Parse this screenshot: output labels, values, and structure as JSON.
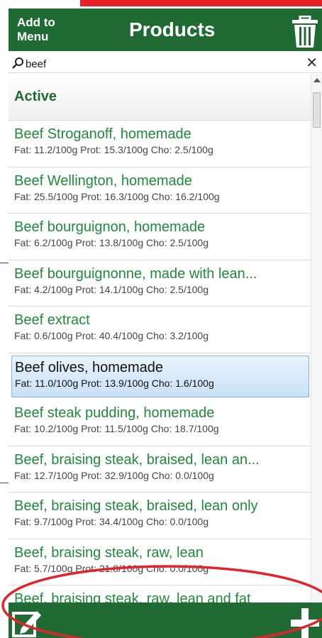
{
  "header": {
    "add_to_menu_line1": "Add to",
    "add_to_menu_line2": "Menu",
    "title": "Products",
    "trash_icon": "trash-icon"
  },
  "search": {
    "value": "beef",
    "placeholder": "",
    "icon": "search-icon",
    "clear_icon": "close-icon"
  },
  "list": {
    "section_title": "Active",
    "items": [
      {
        "name": "Beef Stroganoff, homemade",
        "nutrition": "Fat: 11.2/100g Prot: 15.3/100g Cho: 2.5/100g"
      },
      {
        "name": "Beef Wellington, homemade",
        "nutrition": "Fat: 25.5/100g Prot: 16.3/100g Cho: 16.2/100g"
      },
      {
        "name": "Beef bourguignon, homemade",
        "nutrition": "Fat: 6.2/100g Prot: 13.8/100g Cho: 2.5/100g"
      },
      {
        "name": "Beef bourguignonne, made with lean...",
        "nutrition": "Fat: 4.2/100g Prot: 14.1/100g Cho: 2.5/100g"
      },
      {
        "name": "Beef extract",
        "nutrition": "Fat: 0.6/100g Prot: 40.4/100g Cho: 3.2/100g"
      },
      {
        "name": "Beef olives, homemade",
        "nutrition": "Fat: 11.0/100g Prot: 13.9/100g Cho: 1.6/100g",
        "selected": true
      },
      {
        "name": "Beef steak pudding, homemade",
        "nutrition": "Fat: 10.2/100g Prot: 11.5/100g Cho: 18.7/100g"
      },
      {
        "name": "Beef, braising steak, braised, lean an...",
        "nutrition": "Fat: 12.7/100g Prot: 32.9/100g Cho: 0.0/100g"
      },
      {
        "name": "Beef, braising steak, braised, lean only",
        "nutrition": "Fat: 9.7/100g Prot: 34.4/100g Cho: 0.0/100g"
      },
      {
        "name": "Beef, braising steak, raw, lean",
        "nutrition": "Fat: 5.7/100g Prot: 21.8/100g Cho: 0.0/100g"
      },
      {
        "name": "Beef, braising steak, raw, lean and fat",
        "nutrition": ""
      }
    ]
  },
  "footer": {
    "edit_icon": "edit-icon",
    "add_icon": "plus-icon"
  },
  "colors": {
    "brand_green": "#206a34",
    "item_green": "#1f8a3a",
    "top_bar_red": "#e8202a",
    "annotation_red": "#e3232c",
    "selection_blue": "#c9e1f6"
  }
}
